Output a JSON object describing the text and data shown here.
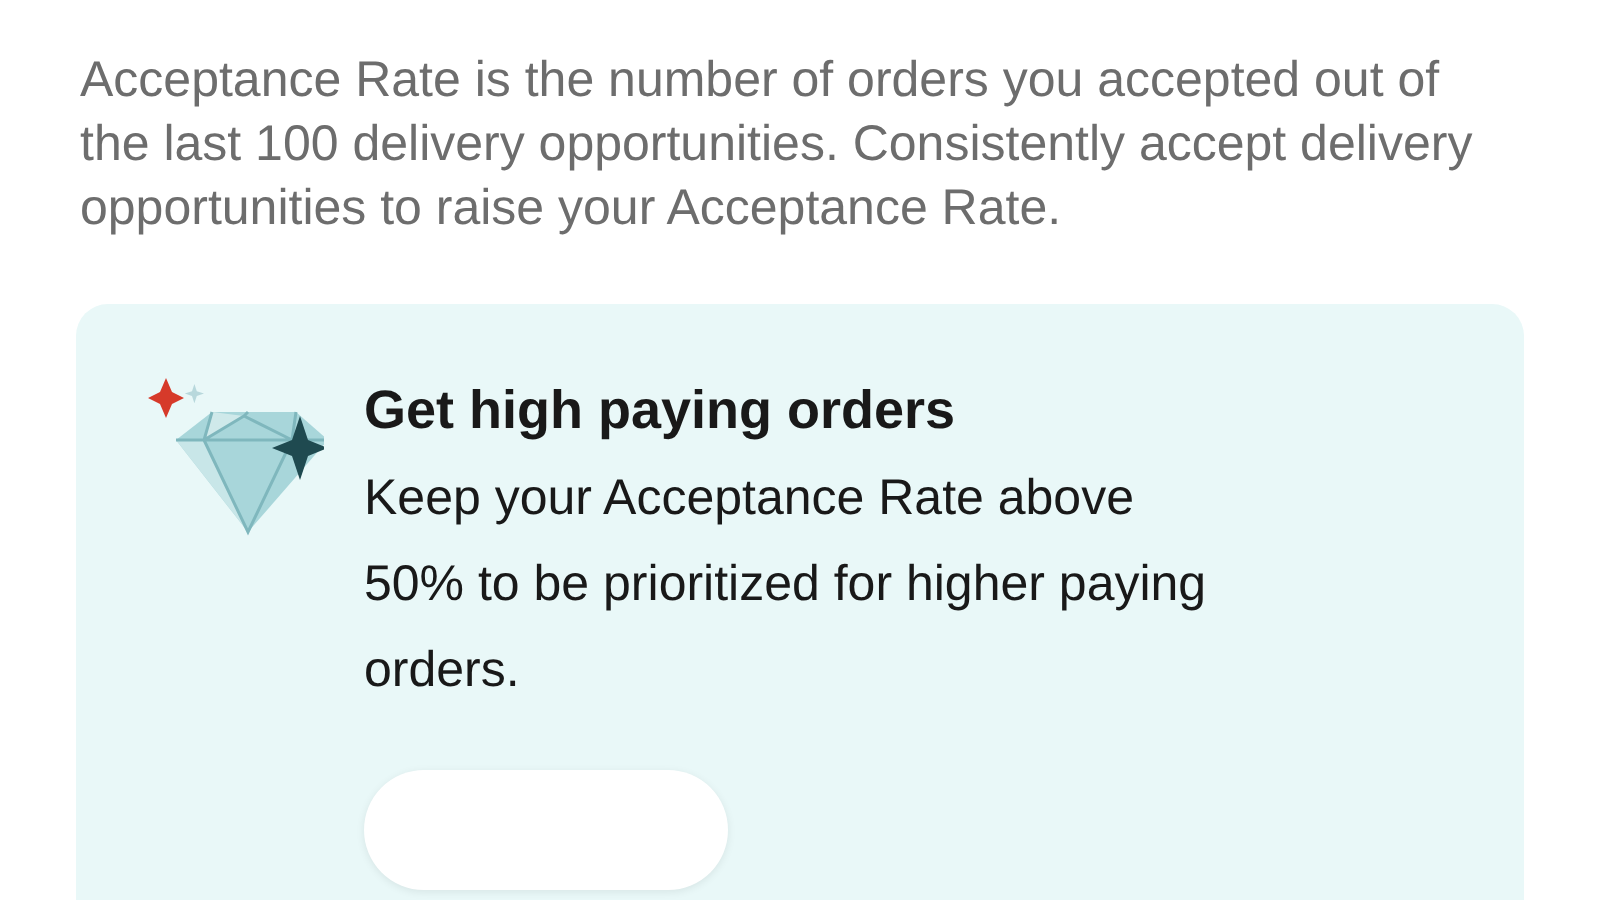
{
  "description": "Acceptance Rate is the number of orders you accepted out of the last 100 delivery opportunities. Consistently accept delivery opportunities to raise your Acceptance Rate.",
  "card": {
    "title": "Get high paying orders",
    "body": "Keep your Acceptance Rate above 50% to be prioritized for higher paying orders."
  }
}
